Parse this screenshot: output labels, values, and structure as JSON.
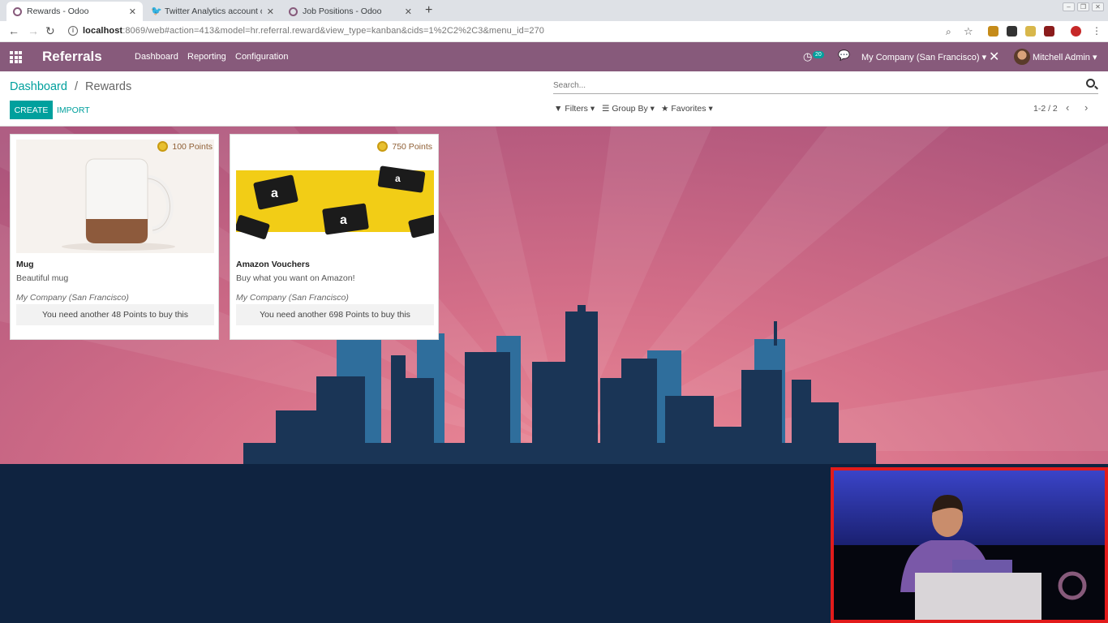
{
  "browser": {
    "tabs": [
      {
        "title": "Rewards - Odoo",
        "icon": "odoo-icon",
        "active": true
      },
      {
        "title": "Twitter Analytics account ov",
        "icon": "twitter-icon",
        "active": false
      },
      {
        "title": "Job Positions - Odoo",
        "icon": "odoo-icon",
        "active": false
      }
    ],
    "url_host": "localhost",
    "url_rest": ":8069/web#action=413&model=hr.referral.reward&view_type=kanban&cids=1%2C2%2C3&menu_id=270"
  },
  "navbar": {
    "app_name": "Referrals",
    "menu": [
      "Dashboard",
      "Reporting",
      "Configuration"
    ],
    "activity_count": "20",
    "company": "My Company (San Francisco)",
    "user": "Mitchell Admin",
    "color": "#875a7b"
  },
  "control": {
    "breadcrumb_parent": "Dashboard",
    "breadcrumb_sep": "/",
    "breadcrumb_current": "Rewards",
    "create_label": "CREATE",
    "import_label": "IMPORT",
    "search_placeholder": "Search...",
    "filters_label": "Filters",
    "groupby_label": "Group By",
    "favorites_label": "Favorites",
    "pager": "1-2 / 2",
    "accent": "#00a09d"
  },
  "rewards": [
    {
      "points": "100 Points",
      "name": "Mug",
      "description": "Beautiful mug",
      "company": "My Company (San Francisco)",
      "need": "You need another 48 Points to buy this"
    },
    {
      "points": "750 Points",
      "name": "Amazon Vouchers",
      "description": "Buy what you want on Amazon!",
      "company": "My Company (San Francisco)",
      "need": "You need another 698 Points to buy this"
    }
  ]
}
